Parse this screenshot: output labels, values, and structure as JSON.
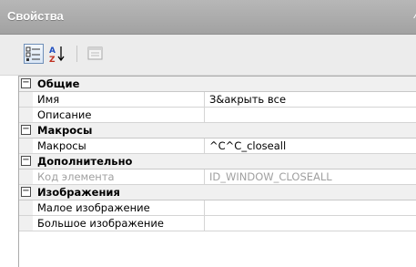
{
  "window": {
    "title": "Свойства",
    "pin_glyph": "⁄"
  },
  "toolbar": {
    "categorized_icon": "categorized-view-icon",
    "alphabetical_icon": "sort-alphabetical-icon",
    "pages_icon": "property-pages-icon"
  },
  "grid": {
    "categories": [
      {
        "label": "Общие",
        "toggle": "−",
        "properties": [
          {
            "name": "Имя",
            "value": "З&акрыть все",
            "disabled": false
          },
          {
            "name": "Описание",
            "value": "",
            "disabled": false
          }
        ]
      },
      {
        "label": "Макросы",
        "toggle": "−",
        "properties": [
          {
            "name": "Макросы",
            "value": "^C^C_closeall",
            "disabled": false
          }
        ]
      },
      {
        "label": "Дополнительно",
        "toggle": "−",
        "properties": [
          {
            "name": "Код элемента",
            "value": "ID_WINDOW_CLOSEALL",
            "disabled": true
          }
        ]
      },
      {
        "label": "Изображения",
        "toggle": "−",
        "properties": [
          {
            "name": "Малое изображение",
            "value": "",
            "disabled": false
          },
          {
            "name": "Большое изображение",
            "value": "",
            "disabled": false
          }
        ]
      }
    ]
  },
  "colors": {
    "titlebar": "#a8a8a8",
    "category_bg": "#f0f0f0",
    "disabled_text": "#a0a0a0"
  }
}
